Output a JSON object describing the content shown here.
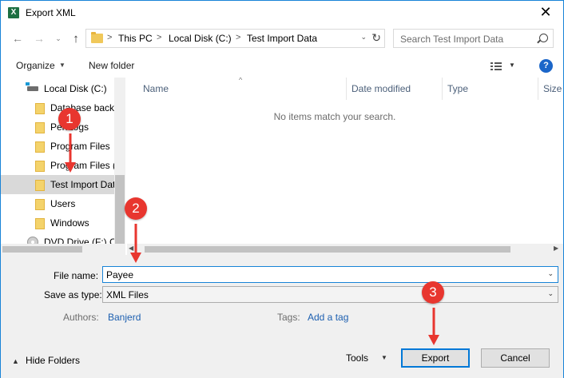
{
  "window": {
    "title": "Export XML",
    "app_icon_letter": "X",
    "close_glyph": "✕"
  },
  "nav": {
    "back_glyph": "←",
    "forward_glyph": "→",
    "history_glyph": "⌄",
    "up_glyph": "↑",
    "breadcrumb": [
      "This PC",
      "Local Disk (C:)",
      "Test Import Data"
    ],
    "crumb_sep": ">",
    "address_dropdown_glyph": "⌄",
    "refresh_glyph": "↻",
    "search_placeholder": "Search Test Import Data"
  },
  "toolbar": {
    "organize": "Organize",
    "organize_dd": "▼",
    "new_folder": "New folder",
    "view_dd": "▼",
    "help": "?"
  },
  "navpane": {
    "items": [
      {
        "label": "Local Disk (C:)",
        "kind": "drive"
      },
      {
        "label": "Database backu",
        "kind": "folder"
      },
      {
        "label": "PerfLogs",
        "kind": "folder"
      },
      {
        "label": "Program Files",
        "kind": "folder"
      },
      {
        "label": "Program Files (",
        "kind": "folder"
      },
      {
        "label": "Test Import Dat",
        "kind": "folder",
        "selected": true
      },
      {
        "label": "Users",
        "kind": "folder"
      },
      {
        "label": "Windows",
        "kind": "folder"
      },
      {
        "label": "DVD Drive (F:) CI",
        "kind": "disc"
      }
    ]
  },
  "filelist": {
    "columns": [
      "Name",
      "Date modified",
      "Type",
      "Size"
    ],
    "sort_caret": "^",
    "empty_message": "No items match your search.",
    "scroll_left": "◀",
    "scroll_right": "▶"
  },
  "form": {
    "file_name_label": "File name:",
    "file_name_value": "Payee",
    "save_as_label": "Save as type:",
    "save_as_value": "XML Files",
    "dropdown_glyph": "⌄",
    "authors_label": "Authors:",
    "authors_value": "Banjerd",
    "tags_label": "Tags:",
    "tags_value": "Add a tag",
    "hide_folders": "Hide Folders",
    "hide_caret": "▲",
    "tools": "Tools",
    "tools_dd": "▼",
    "export": "Export",
    "cancel": "Cancel"
  },
  "annotations": [
    {
      "number": "1",
      "color": "#e8362f"
    },
    {
      "number": "2",
      "color": "#e8362f"
    },
    {
      "number": "3",
      "color": "#e8362f"
    }
  ],
  "colors": {
    "accent": "#1883d7",
    "folder": "#f4d36b",
    "link": "#1c5fb0",
    "callout": "#e8362f"
  }
}
